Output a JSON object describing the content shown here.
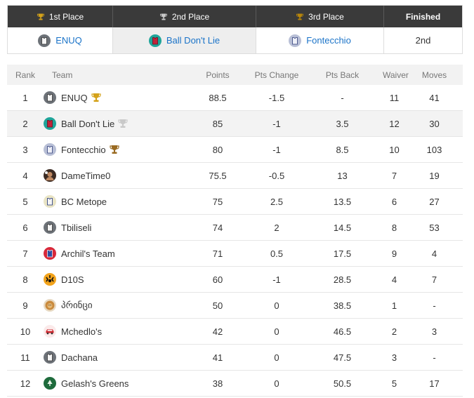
{
  "podium": {
    "headers": [
      {
        "label": "1st Place",
        "trophy_color": "#d4a21a"
      },
      {
        "label": "2nd Place",
        "trophy_color": "#c9c9c9"
      },
      {
        "label": "3rd Place",
        "trophy_color": "#b8860b"
      },
      {
        "label": "Finished"
      }
    ],
    "places": [
      {
        "team": "ENUQ",
        "icon": "grey-jersey-icon"
      },
      {
        "team": "Ball Don't Lie",
        "icon": "teal-red-jersey-icon"
      },
      {
        "team": "Fontecchio",
        "icon": "navy-jersey-icon"
      },
      {
        "finished": "2nd"
      }
    ]
  },
  "table": {
    "columns": [
      "Rank",
      "Team",
      "Points",
      "Pts Change",
      "Pts Back",
      "Waiver",
      "Moves"
    ],
    "rows": [
      {
        "rank": "1",
        "team": "ENUQ",
        "icon": "grey-jersey-icon",
        "trophy": "gold",
        "points": "88.5",
        "pts_change": "-1.5",
        "change_sign": "neg",
        "pts_back": "-",
        "waiver": "11",
        "moves": "41"
      },
      {
        "rank": "2",
        "team": "Ball Don't Lie",
        "icon": "teal-red-jersey-icon",
        "trophy": "silver",
        "points": "85",
        "pts_change": "-1",
        "change_sign": "neg",
        "pts_back": "3.5",
        "waiver": "12",
        "moves": "30",
        "highlight": true
      },
      {
        "rank": "3",
        "team": "Fontecchio",
        "icon": "navy-jersey-icon",
        "trophy": "bronze",
        "points": "80",
        "pts_change": "-1",
        "change_sign": "neg",
        "pts_back": "8.5",
        "waiver": "10",
        "moves": "103"
      },
      {
        "rank": "4",
        "team": "DameTime0",
        "icon": "player-avatar-icon",
        "points": "75.5",
        "pts_change": "-0.5",
        "change_sign": "neg",
        "pts_back": "13",
        "waiver": "7",
        "moves": "19"
      },
      {
        "rank": "5",
        "team": "BC Metope",
        "icon": "blue-yellow-jersey-icon",
        "points": "75",
        "pts_change": "2.5",
        "change_sign": "pos",
        "pts_back": "13.5",
        "waiver": "6",
        "moves": "27"
      },
      {
        "rank": "6",
        "team": "Tbiliseli",
        "icon": "grey-jersey-icon",
        "points": "74",
        "pts_change": "2",
        "change_sign": "pos",
        "pts_back": "14.5",
        "waiver": "8",
        "moves": "53"
      },
      {
        "rank": "7",
        "team": "Archil's Team",
        "icon": "red-blue-jersey-icon",
        "points": "71",
        "pts_change": "0.5",
        "change_sign": "pos",
        "pts_back": "17.5",
        "waiver": "9",
        "moves": "4"
      },
      {
        "rank": "8",
        "team": "D10S",
        "icon": "tiger-logo-icon",
        "points": "60",
        "pts_change": "-1",
        "change_sign": "neg",
        "pts_back": "28.5",
        "waiver": "4",
        "moves": "7"
      },
      {
        "rank": "9",
        "team": "პრინცი",
        "icon": "lion-logo-icon",
        "points": "50",
        "pts_change": "0",
        "change_sign": "zero",
        "pts_back": "38.5",
        "waiver": "1",
        "moves": "-"
      },
      {
        "rank": "10",
        "team": "Mchedlo's",
        "icon": "red-car-icon",
        "points": "42",
        "pts_change": "0",
        "change_sign": "zero",
        "pts_back": "46.5",
        "waiver": "2",
        "moves": "3"
      },
      {
        "rank": "11",
        "team": "Dachana",
        "icon": "grey-jersey-icon",
        "points": "41",
        "pts_change": "0",
        "change_sign": "zero",
        "pts_back": "47.5",
        "waiver": "3",
        "moves": "-"
      },
      {
        "rank": "12",
        "team": "Gelash's Greens",
        "icon": "green-tree-icon",
        "points": "38",
        "pts_change": "0",
        "change_sign": "zero",
        "pts_back": "50.5",
        "waiver": "5",
        "moves": "17"
      }
    ]
  },
  "colors": {
    "header_bg": "#3a3a3a",
    "link": "#1a73c8",
    "negative": "#d0021b",
    "positive": "#2bb02b"
  }
}
